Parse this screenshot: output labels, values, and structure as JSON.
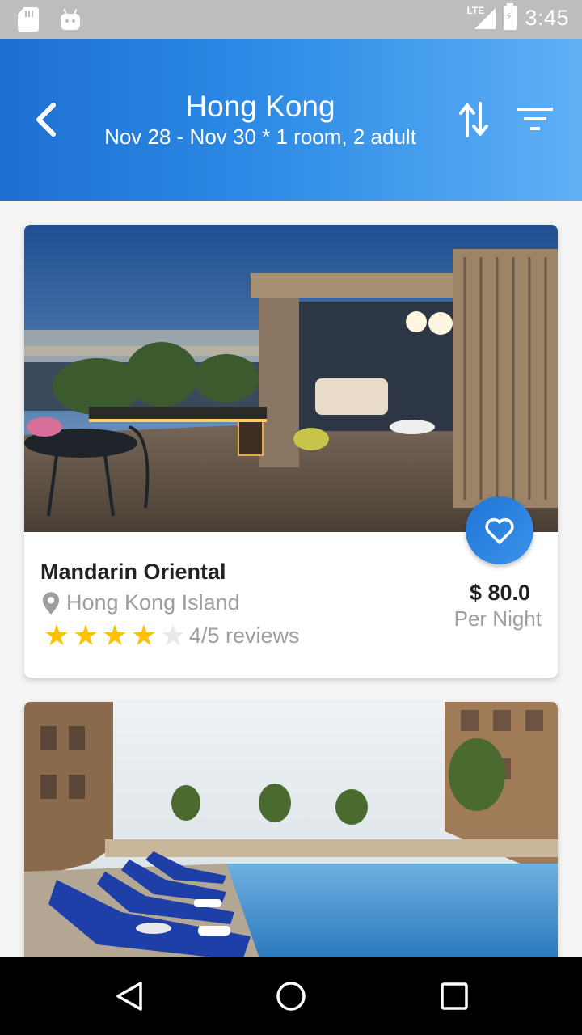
{
  "status_bar": {
    "network": "LTE",
    "time": "3:45",
    "icons": [
      "sd-card-icon",
      "android-icon",
      "signal-icon",
      "battery-charging-icon"
    ]
  },
  "header": {
    "title": "Hong Kong",
    "subtitle": "Nov 28 - Nov 30 * 1 room, 2 adult",
    "icons": [
      "back-arrow-icon",
      "sort-icon",
      "filter-icon"
    ],
    "colors": {
      "gradient_start": "#1e6fd0",
      "gradient_end": "#5fb0f5"
    }
  },
  "hotels": [
    {
      "name": "Mandarin Oriental",
      "location": "Hong Kong Island",
      "rating": 4,
      "rating_max": 5,
      "reviews_label": "4/5 reviews",
      "price": "$ 80.0",
      "price_unit": "Per Night",
      "image": "rooftop-terrace-photo",
      "favorite_icon": "heart-outline-icon"
    },
    {
      "image": "hotel-pool-photo"
    }
  ],
  "colors": {
    "accent": "#2680df",
    "star": "#ffc107",
    "muted_text": "#9e9e9e"
  },
  "nav_bar": {
    "icons": [
      "nav-back-icon",
      "nav-home-icon",
      "nav-recents-icon"
    ]
  }
}
